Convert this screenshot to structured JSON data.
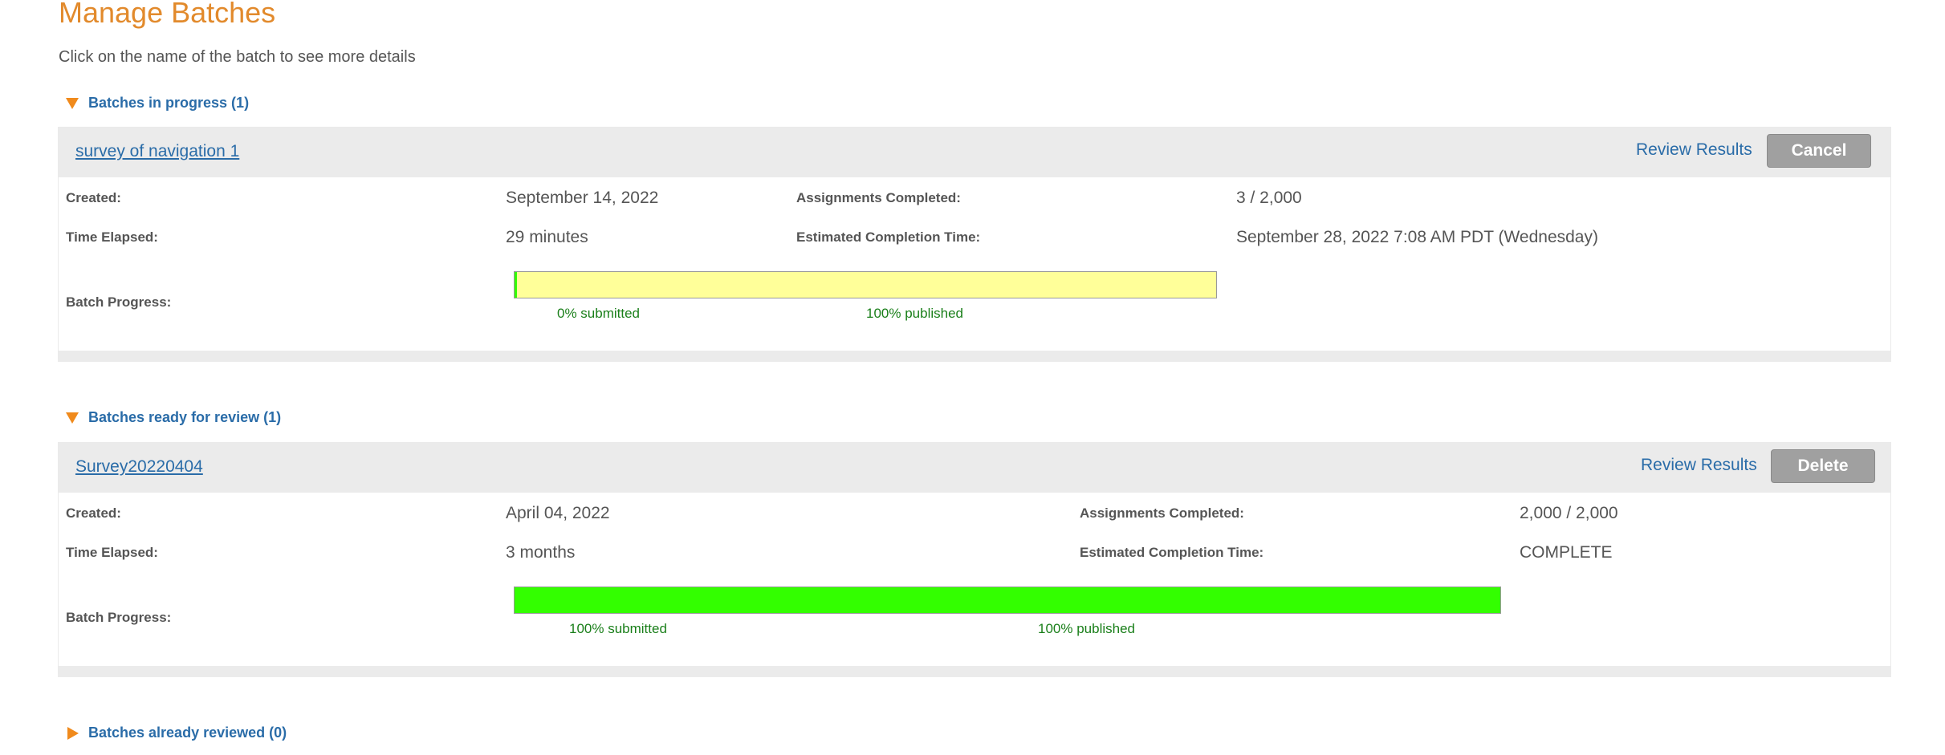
{
  "page": {
    "title": "Manage Batches",
    "subtitle": "Click on the name of the batch to see more details"
  },
  "labels": {
    "created": "Created:",
    "time_elapsed": "Time Elapsed:",
    "batch_progress": "Batch Progress:",
    "assignments_completed": "Assignments Completed:",
    "estimated_completion": "Estimated Completion Time:"
  },
  "sections": {
    "in_progress": {
      "heading": "Batches in progress (1)",
      "expanded": true,
      "batch": {
        "name": "survey of navigation 1",
        "review_label": "Review Results",
        "action_label": "Cancel",
        "created": "September 14, 2022",
        "time_elapsed": "29 minutes",
        "assignments_completed": "3 / 2,000",
        "estimated_completion": "September 28, 2022 7:08 AM PDT (Wednesday)",
        "submitted_text": "0% submitted",
        "published_text": "100% published",
        "submitted_fraction": 0.0,
        "published_fraction": 1.0,
        "bar_color": "#ffff99",
        "submitted_color": "#33ff00"
      }
    },
    "ready_for_review": {
      "heading": "Batches ready for review (1)",
      "expanded": true,
      "batch": {
        "name": "Survey20220404",
        "review_label": "Review Results",
        "action_label": "Delete",
        "created": "April 04, 2022",
        "time_elapsed": "3 months",
        "assignments_completed": "2,000 / 2,000",
        "estimated_completion": "COMPLETE",
        "submitted_text": "100% submitted",
        "published_text": "100% published",
        "submitted_fraction": 1.0,
        "published_fraction": 1.0,
        "bar_color": "#33ff00",
        "submitted_color": "#33ff00"
      }
    },
    "already_reviewed": {
      "heading": "Batches already reviewed (0)",
      "expanded": false
    }
  },
  "colors": {
    "title_orange": "#e28a2c",
    "link_blue": "#2a6ca8",
    "toggle_orange": "#f08a1c",
    "progress_text_green": "#1a7f1a",
    "button_gray": "#a0a0a0"
  },
  "icons": {
    "expanded": "triangle-down-icon",
    "collapsed": "triangle-right-icon"
  }
}
